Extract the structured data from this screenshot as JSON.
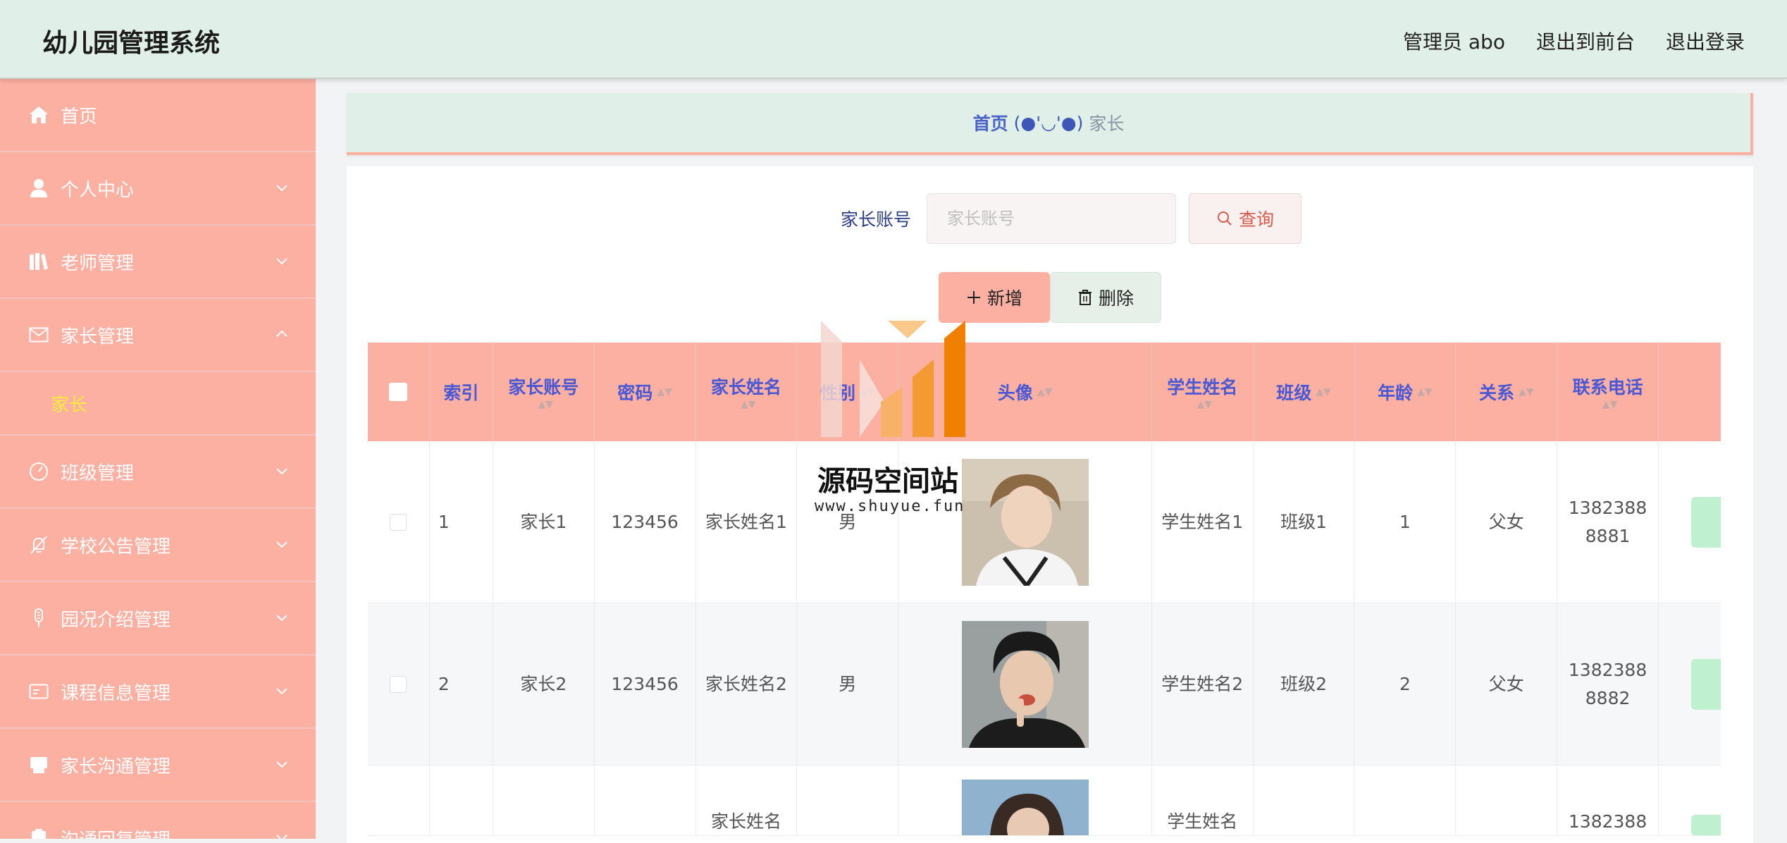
{
  "header": {
    "title": "幼儿园管理系统",
    "admin_label": "管理员 abo",
    "to_front_label": "退出到前台",
    "logout_label": "退出登录"
  },
  "sidebar": {
    "items": [
      {
        "label": "首页",
        "icon": "home-icon"
      },
      {
        "label": "个人中心",
        "icon": "user-icon"
      },
      {
        "label": "老师管理",
        "icon": "books-icon"
      },
      {
        "label": "家长管理",
        "icon": "mail-icon",
        "expanded": true,
        "children": [
          {
            "label": "家长"
          }
        ]
      },
      {
        "label": "班级管理",
        "icon": "gauge-icon"
      },
      {
        "label": "学校公告管理",
        "icon": "bell-off-icon"
      },
      {
        "label": "园况介绍管理",
        "icon": "microphone-icon"
      },
      {
        "label": "课程信息管理",
        "icon": "card-icon"
      },
      {
        "label": "家长沟通管理",
        "icon": "printer-icon"
      },
      {
        "label": "沟通回复管理",
        "icon": "clipboard-icon"
      }
    ]
  },
  "breadcrumb": {
    "home": "首页",
    "separator": "(●'◡'●)",
    "current": "家长"
  },
  "search": {
    "label": "家长账号",
    "placeholder": "家长账号",
    "button": "查询"
  },
  "actions": {
    "add": "新增",
    "delete": "删除"
  },
  "table": {
    "columns": [
      "索引",
      "家长账号",
      "密码",
      "家长姓名",
      "性别",
      "头像",
      "学生姓名",
      "班级",
      "年龄",
      "关系",
      "联系电话"
    ],
    "rows": [
      {
        "index": "1",
        "account": "家长1",
        "password": "123456",
        "name": "家长姓名1",
        "gender": "男",
        "student": "学生姓名1",
        "class": "班级1",
        "age": "1",
        "relation": "父女",
        "phone": "13823888881"
      },
      {
        "index": "2",
        "account": "家长2",
        "password": "123456",
        "name": "家长姓名2",
        "gender": "男",
        "student": "学生姓名2",
        "class": "班级2",
        "age": "2",
        "relation": "父女",
        "phone": "13823888882"
      },
      {
        "index": "",
        "account": "",
        "password": "",
        "name": "家长姓名",
        "gender": "",
        "student": "学生姓名",
        "class": "",
        "age": "",
        "relation": "",
        "phone": "1382388"
      }
    ]
  },
  "watermark": {
    "title": "源码空间站",
    "url": "www.shuyue.fun"
  },
  "colors": {
    "sidebar": "#fbb0a2",
    "header": "#e0f0e8",
    "accent_text": "#4a58d4",
    "active_submenu": "#f8ec3c",
    "edit_button": "#bff0cf"
  }
}
